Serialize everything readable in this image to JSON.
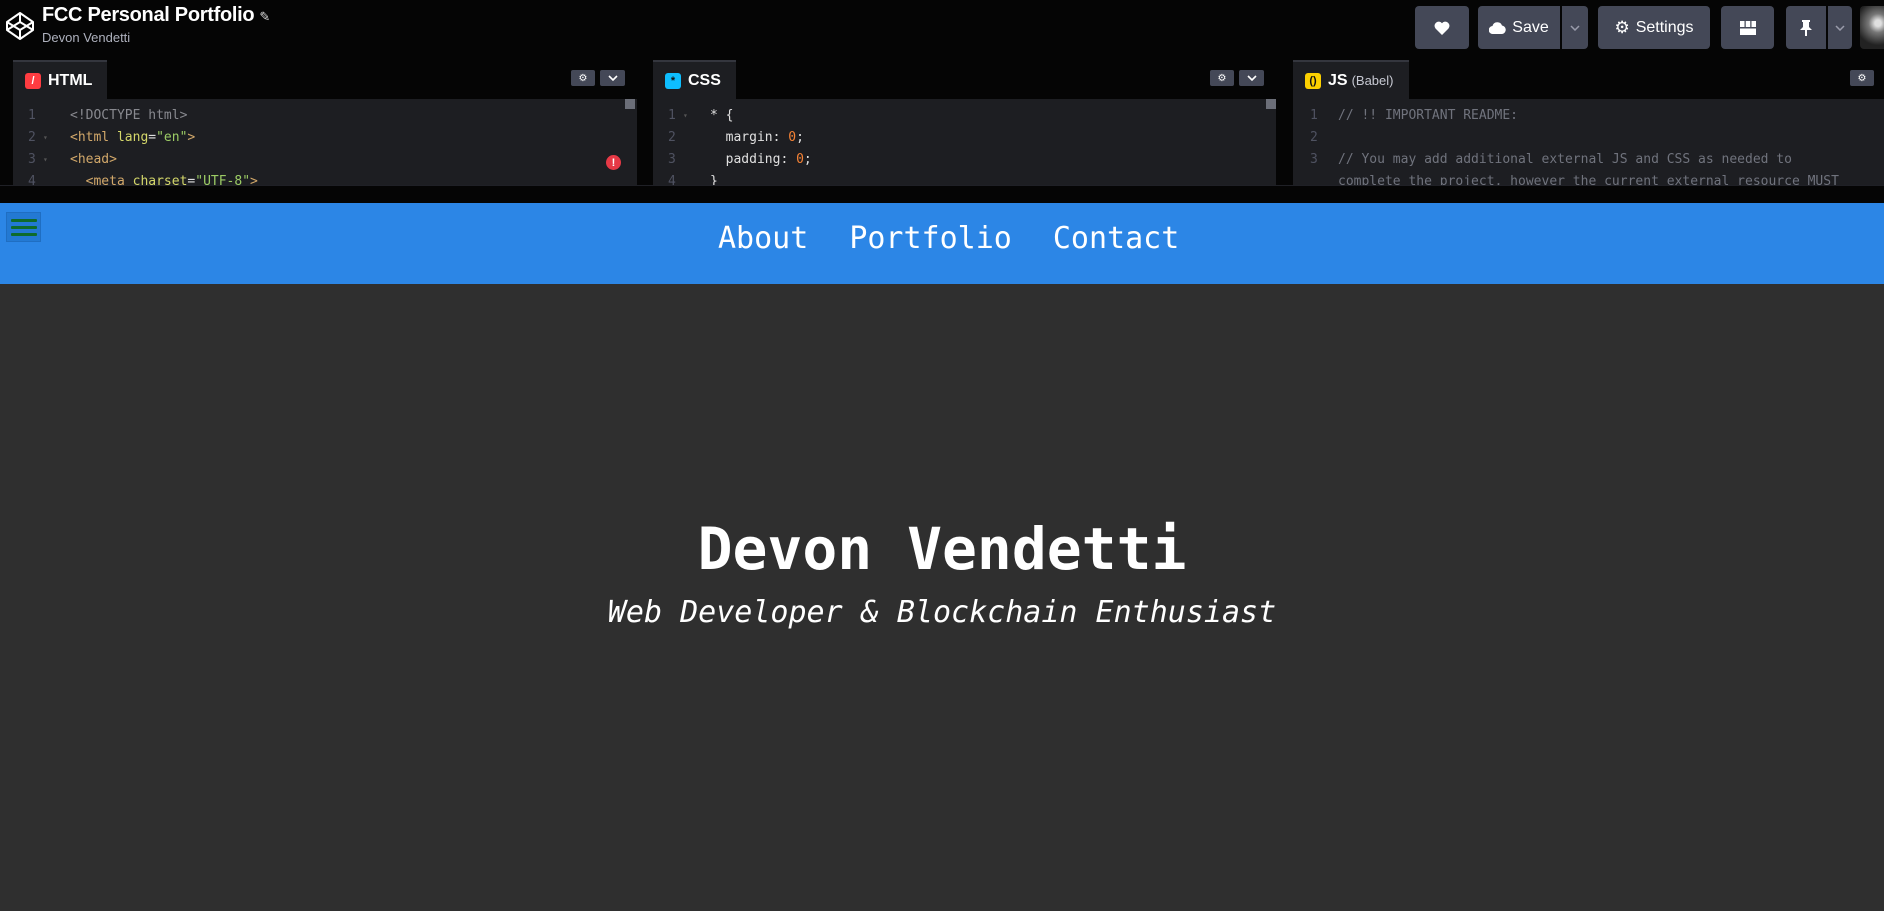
{
  "header": {
    "title": "FCC Personal Portfolio",
    "author": "Devon Vendetti",
    "save_label": "Save",
    "settings_label": "Settings"
  },
  "editors": {
    "html": {
      "label": "HTML",
      "lines": [
        {
          "n": "1",
          "parts": [
            {
              "c": "c-doc",
              "t": "<!DOCTYPE html>"
            }
          ]
        },
        {
          "n": "2",
          "parts": [
            {
              "c": "c-tag",
              "t": "<html "
            },
            {
              "c": "c-attr",
              "t": "lang"
            },
            {
              "c": "c-plain",
              "t": "="
            },
            {
              "c": "c-str",
              "t": "\"en\""
            },
            {
              "c": "c-tag",
              "t": ">"
            }
          ]
        },
        {
          "n": "3",
          "parts": [
            {
              "c": "c-tag",
              "t": "<head>"
            }
          ]
        },
        {
          "n": "4",
          "parts": [
            {
              "c": "c-tag",
              "t": "  <meta "
            },
            {
              "c": "c-attr",
              "t": "charset"
            },
            {
              "c": "c-plain",
              "t": "="
            },
            {
              "c": "c-str",
              "t": "\"UTF-8\""
            },
            {
              "c": "c-tag",
              "t": ">"
            }
          ]
        }
      ]
    },
    "css": {
      "label": "CSS",
      "lines": [
        {
          "n": "1",
          "parts": [
            {
              "c": "c-plain",
              "t": "* {"
            }
          ]
        },
        {
          "n": "2",
          "parts": [
            {
              "c": "c-plain",
              "t": "  margin: "
            },
            {
              "c": "c-num",
              "t": "0"
            },
            {
              "c": "c-plain",
              "t": ";"
            }
          ]
        },
        {
          "n": "3",
          "parts": [
            {
              "c": "c-plain",
              "t": "  padding: "
            },
            {
              "c": "c-num",
              "t": "0"
            },
            {
              "c": "c-plain",
              "t": ";"
            }
          ]
        },
        {
          "n": "4",
          "parts": [
            {
              "c": "c-plain",
              "t": "}"
            }
          ]
        }
      ]
    },
    "js": {
      "label": "JS",
      "sublabel": "(Babel)",
      "lines": [
        {
          "n": "1",
          "parts": [
            {
              "c": "c-com",
              "t": "// !! IMPORTANT README:"
            }
          ]
        },
        {
          "n": "2",
          "parts": []
        },
        {
          "n": "3",
          "parts": [
            {
              "c": "c-com",
              "t": "// You may add additional external JS and CSS as needed to"
            }
          ]
        },
        {
          "n": "",
          "parts": [
            {
              "c": "c-com",
              "t": "complete the project, however the current external resource MUST"
            }
          ]
        }
      ]
    }
  },
  "preview": {
    "nav": [
      "About",
      "Portfolio",
      "Contact"
    ],
    "name": "Devon Vendetti",
    "tagline": "Web Developer & Blockchain Enthusiast"
  },
  "colors": {
    "nav_bg": "#2c86e6",
    "page_bg": "#2f2f2f",
    "editor_bg": "#1d1e22",
    "button_bg": "#444857"
  }
}
